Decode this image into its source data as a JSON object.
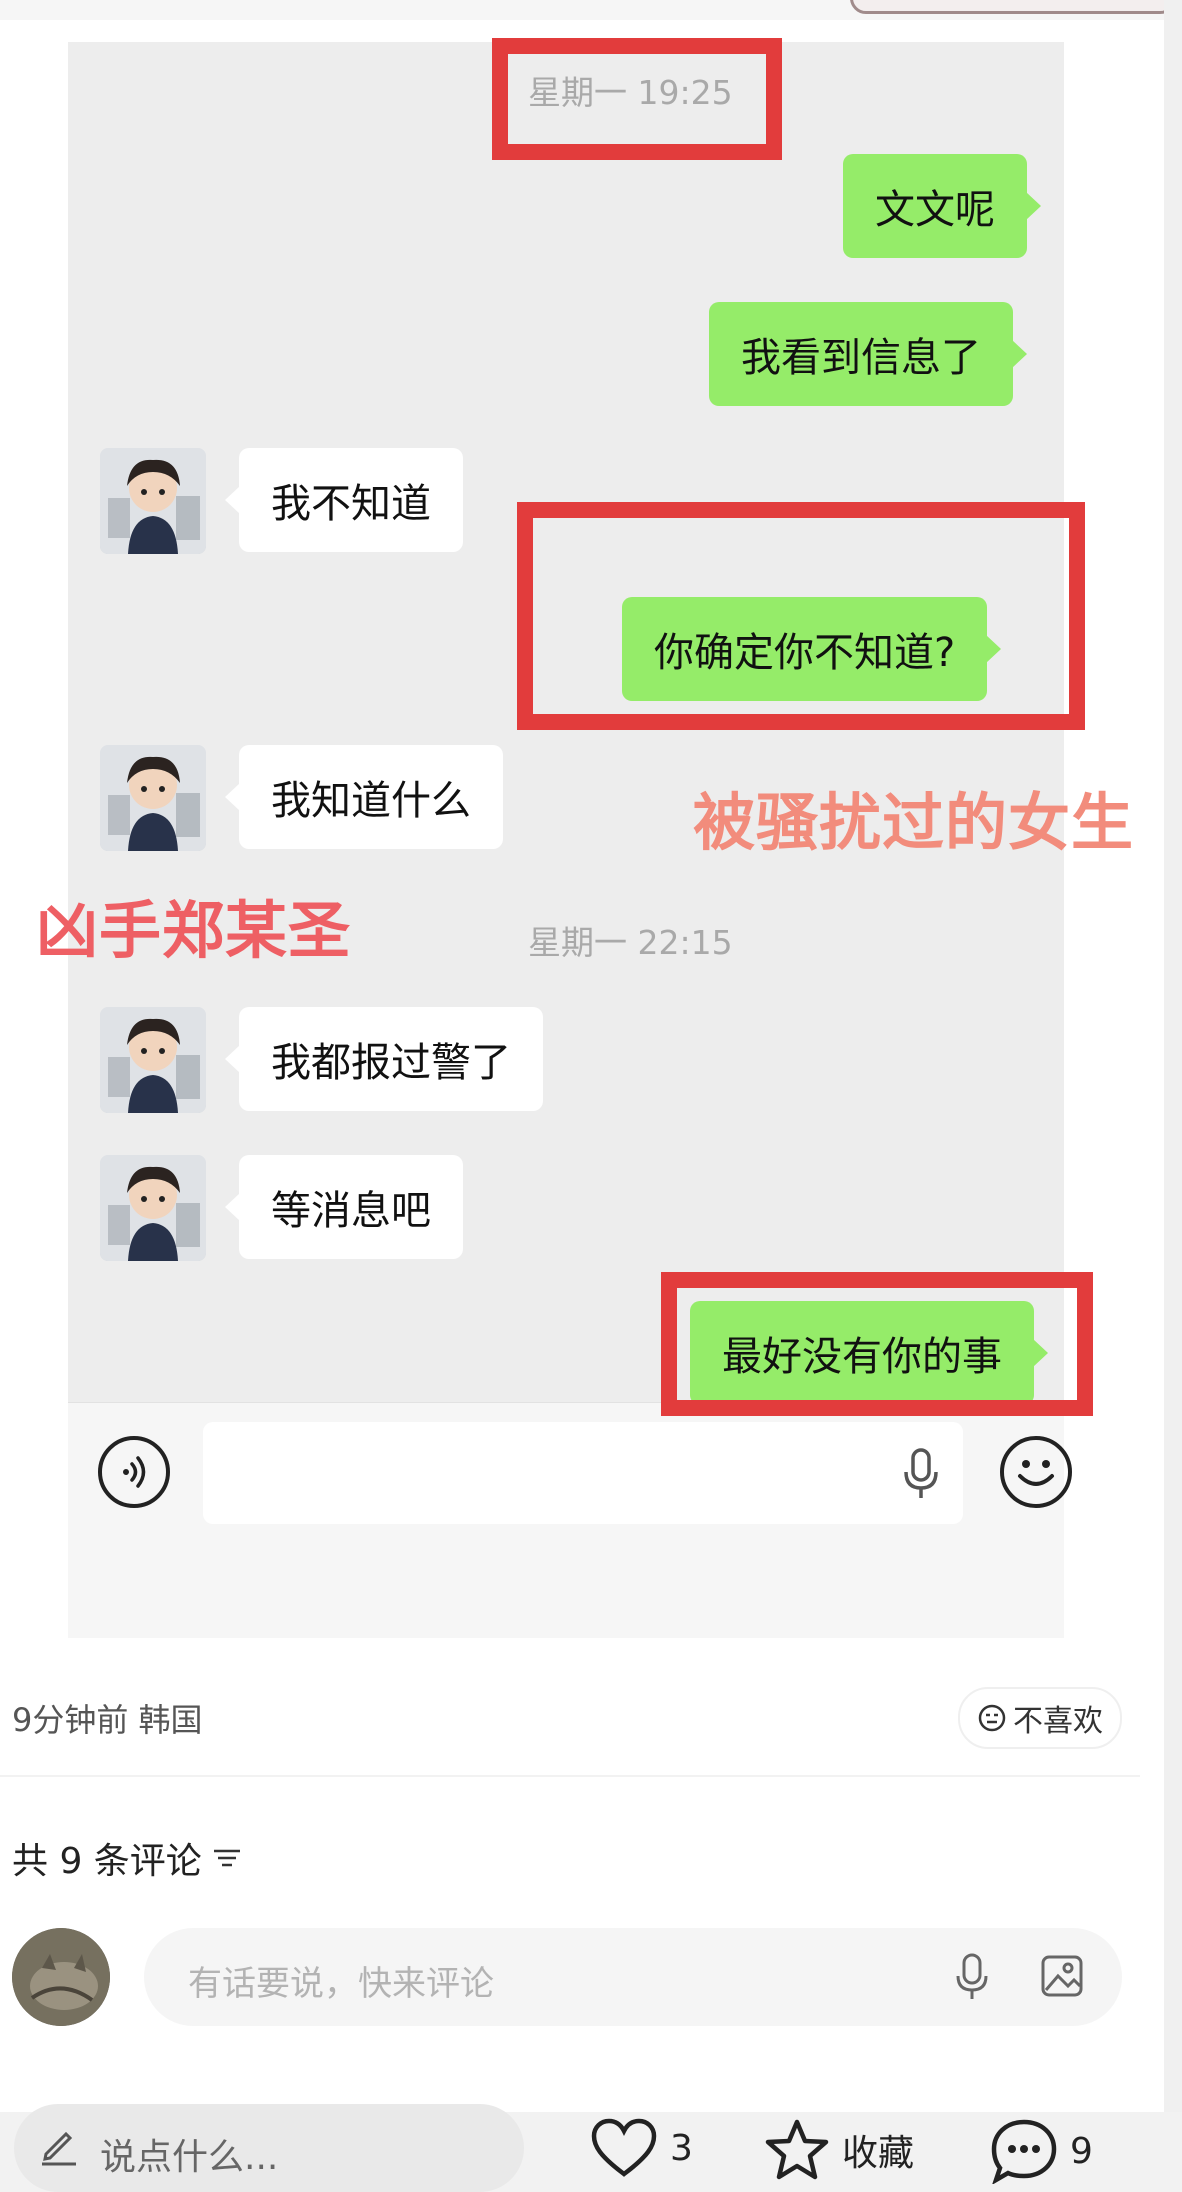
{
  "chat": {
    "timestamps": [
      "星期一 19:25",
      "星期一 22:15"
    ],
    "messages": [
      {
        "side": "out",
        "text": "文文呢"
      },
      {
        "side": "out",
        "text": "我看到信息了"
      },
      {
        "side": "in",
        "text": "我不知道"
      },
      {
        "side": "out",
        "text": "你确定你不知道?"
      },
      {
        "side": "in",
        "text": "我知道什么"
      },
      {
        "side": "in",
        "text": "我都报过警了"
      },
      {
        "side": "in",
        "text": "等消息吧"
      },
      {
        "side": "out",
        "text": "最好没有你的事"
      }
    ]
  },
  "captions": {
    "right": "被骚扰过的女生",
    "left": "凶手郑某圣"
  },
  "colors": {
    "outgoing_bubble": "#95ec69",
    "incoming_bubble": "#ffffff",
    "highlight_box": "#e23c3c",
    "caption_color": "#f06a6a"
  },
  "post": {
    "meta": "9分钟前 韩国",
    "dislike_label": "不喜欢",
    "comments_header": "共 9 条评论",
    "comment_placeholder": "有话要说，快来评论"
  },
  "bottom": {
    "say_placeholder": "说点什么...",
    "likes": "3",
    "favorite_label": "收藏",
    "comments": "9"
  },
  "icons": [
    "voice-icon",
    "mic-icon",
    "emoji-icon",
    "face-icon",
    "sort-icon",
    "image-icon",
    "pen-icon",
    "heart-icon",
    "star-icon",
    "comment-icon"
  ]
}
